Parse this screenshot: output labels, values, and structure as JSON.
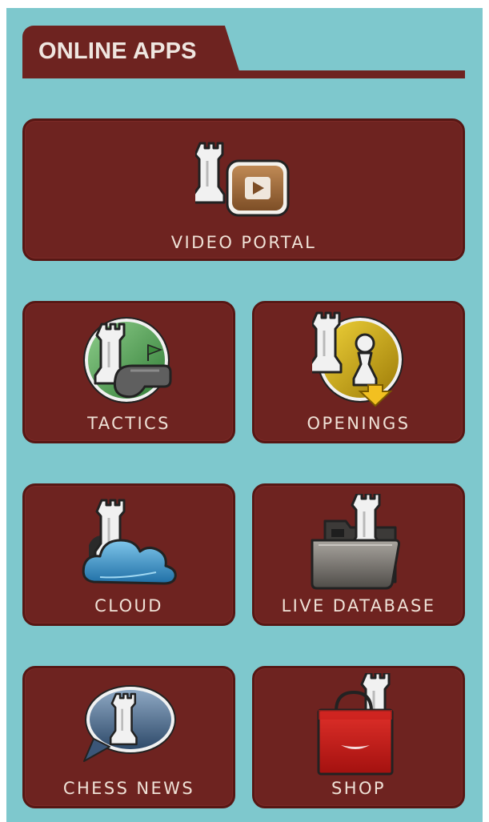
{
  "header": {
    "title": "ONLINE APPS"
  },
  "apps": [
    {
      "label": "VIDEO PORTAL",
      "icon": "rook-video-play-icon"
    },
    {
      "label": "TACTICS",
      "icon": "rook-whistle-icon"
    },
    {
      "label": "OPENINGS",
      "icon": "rook-pawn-arrow-icon"
    },
    {
      "label": "CLOUD",
      "icon": "rook-cloud-icon"
    },
    {
      "label": "LIVE DATABASE",
      "icon": "rook-folder-icon"
    },
    {
      "label": "CHESS NEWS",
      "icon": "rook-speech-bubble-icon"
    },
    {
      "label": "SHOP",
      "icon": "rook-shopping-bag-icon"
    }
  ],
  "colors": {
    "background": "#7ec8cd",
    "tile": "#6e2320",
    "tile_border": "#561714",
    "label_text": "#efe1d6"
  }
}
